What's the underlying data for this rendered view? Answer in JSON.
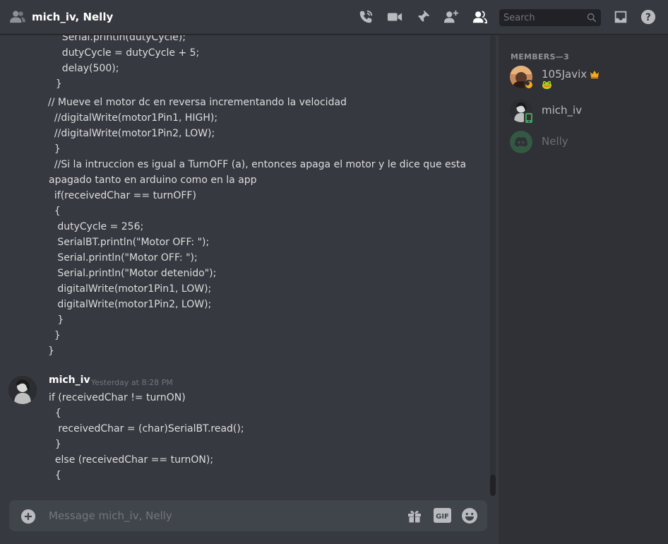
{
  "header": {
    "title": "mich_iv, Nelly",
    "search_placeholder": "Search"
  },
  "messages": {
    "previous_code": [
      "    Serial.println(dutyCycle);",
      "    dutyCycle = dutyCycle + 5;",
      "    delay(500);",
      "  }",
      "// Mueve el motor dc en reversa incrementando la velocidad",
      "  //digitalWrite(motor1Pin1, HIGH);",
      "  //digitalWrite(motor1Pin2, LOW);",
      "  }",
      "  //Si la intruccion es igual a TurnOFF (a), entonces apaga el motor y le dice que esta",
      "apagado tanto en arduino como en la app",
      "  if(receivedChar == turnOFF)",
      "  {",
      "   dutyCycle = 256;",
      "   SerialBT.println(\"Motor OFF: \");",
      "   Serial.println(\"Motor OFF: \");",
      "   Serial.println(\"Motor detenido\");",
      "   digitalWrite(motor1Pin1, LOW);",
      "   digitalWrite(motor1Pin2, LOW);",
      "   }",
      "  }",
      "}"
    ],
    "message": {
      "author": "mich_iv",
      "timestamp": "Yesterday at 8:28 PM",
      "lines": [
        "if (receivedChar != turnON)",
        "  {",
        "   receivedChar = (char)SerialBT.read();",
        "  }",
        "  else (receivedChar == turnON);",
        "  {"
      ]
    }
  },
  "composer": {
    "placeholder": "Message mich_iv, Nelly",
    "gif_label": "GIF"
  },
  "members": {
    "heading": "MEMBERS—3",
    "list": [
      {
        "name": "105Javix",
        "name_color": "#dcddde",
        "status": "idle",
        "badge": "crown",
        "activity": "🐸"
      },
      {
        "name": "mich_iv",
        "name_color": "#dcddde",
        "status": "mobile-online"
      },
      {
        "name": "Nelly",
        "name_color": "#5c6066",
        "status": "offline"
      }
    ]
  },
  "colors": {
    "background": "#36393f",
    "sidebar": "#2f3136",
    "accent": "#5865f2",
    "online": "#3ba55c",
    "idle": "#faa81a",
    "crown": "#faa81a"
  }
}
